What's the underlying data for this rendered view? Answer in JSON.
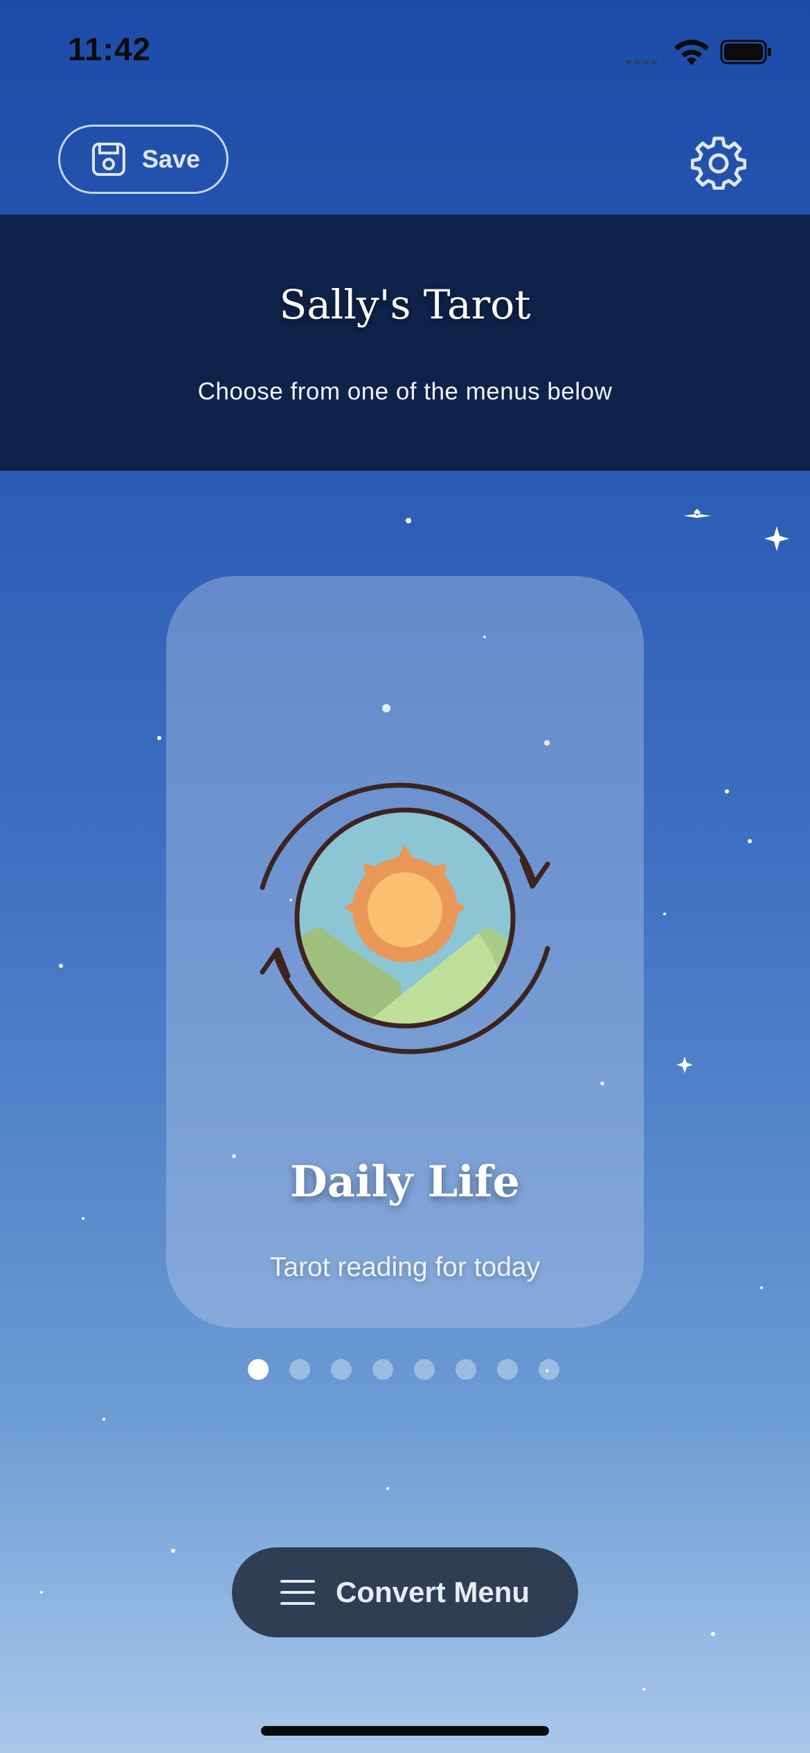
{
  "status_bar": {
    "time": "11:42"
  },
  "toolbar": {
    "save_label": "Save",
    "save_icon": "floppy-disk-icon",
    "settings_icon": "gear-icon"
  },
  "header": {
    "title": "Sally's Tarot",
    "subtitle": "Choose from one of the menus below"
  },
  "carousel": {
    "current_card": {
      "title": "Daily Life",
      "subtitle": "Tarot reading for today",
      "icon": "sun-cycle-icon"
    },
    "page_count": 8,
    "active_index": 0
  },
  "bottom": {
    "convert_label": "Convert Menu",
    "convert_icon": "hamburger-menu-icon"
  },
  "colors": {
    "header_band": "#0f2249",
    "convert_button": "#2f3e54",
    "background_top": "#1d4ca8",
    "background_bottom": "#a9c8ea"
  }
}
